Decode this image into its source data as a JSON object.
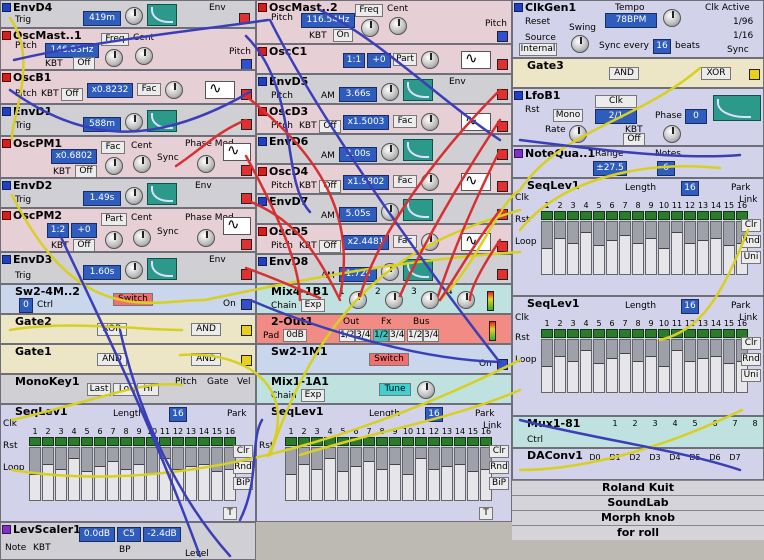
{
  "modules": {
    "envd4": {
      "title": "EnvD4",
      "trig": "Trig",
      "time": "419m",
      "env": "Env"
    },
    "oscmaster1": {
      "title": "OscMast..1",
      "pitch": "Pitch",
      "freq_label": "Freq",
      "cent_label": "Cent",
      "freq_value": "146.83Hz",
      "kbt": "KBT",
      "kbt_state": "Off",
      "pitch_out": "Pitch"
    },
    "oscb1": {
      "title": "OscB1",
      "pitch": "Pitch",
      "kbt": "KBT",
      "kbt_state": "Off",
      "ratio": "x0.8232",
      "fac": "Fac"
    },
    "envd1": {
      "title": "EnvD1",
      "trig": "Trig",
      "time": "588m"
    },
    "oscpm1": {
      "title": "OscPM1",
      "ratio": "x0.6802",
      "fac": "Fac",
      "cent": "Cent",
      "kbt": "KBT",
      "kbt_state": "Off",
      "sync": "Sync",
      "phase_mod": "Phase Mod"
    },
    "envd2": {
      "title": "EnvD2",
      "trig": "Trig",
      "time": "1.49s",
      "env": "Env"
    },
    "oscpm2": {
      "title": "OscPM2",
      "ratio": "1:2",
      "offset": "+0",
      "part": "Part",
      "cent": "Cent",
      "kbt": "KBT",
      "kbt_state": "Off",
      "sync": "Sync",
      "phase_mod": "Phase Mod"
    },
    "envd3": {
      "title": "EnvD3",
      "trig": "Trig",
      "time": "1.60s",
      "env": "Env"
    },
    "sw2_4m": {
      "title": "Sw2-4M..2",
      "ctrl_value": "0",
      "ctrl": "Ctrl",
      "switch": "Switch",
      "on": "On"
    },
    "gate2": {
      "title": "Gate2",
      "op1": "XOR",
      "op2": "AND"
    },
    "gate1": {
      "title": "Gate1",
      "op1": "AND",
      "op2": "AND"
    },
    "monokey1": {
      "title": "MonoKey1",
      "last": "Last",
      "lo": "Lo",
      "hi": "Hi",
      "pitch": "Pitch",
      "gate": "Gate",
      "vel": "Vel"
    },
    "seqlev_bl": {
      "title": "SeqLev1",
      "length_label": "Length",
      "length": "16",
      "park": "Park",
      "link": "Link",
      "clk": "Clk",
      "rst": "Rst",
      "loop": "Loop",
      "clr": "Clr",
      "rnd": "Rnd",
      "bip": "BiP",
      "t": "T"
    },
    "levscaler1": {
      "title": "LevScaler1",
      "note": "Note",
      "kbt": "KBT",
      "gain1": "0.0dB",
      "note_val": "C5",
      "gain2": "-2.4dB",
      "bp": "BP",
      "level": "Level"
    },
    "envd4_osc2": {
      "title": "OscMast..2",
      "pitch": "Pitch",
      "freq_value": "116.54Hz",
      "freq_label": "Freq",
      "cent_label": "Cent",
      "kbt": "KBT",
      "kbt_state": "On",
      "pitch_out": "Pitch"
    },
    "osc2": {
      "title": "OscC1",
      "ratio": "1:1",
      "offset": "+0",
      "part": "Part"
    },
    "envd5": {
      "title": "EnvD5",
      "am": "AM",
      "pitch": "Pitch",
      "time": "3.66s",
      "env": "Env"
    },
    "oscd3": {
      "title": "OscD3",
      "pitch": "Pitch",
      "kbt": "KBT",
      "kbt_state": "Off",
      "ratio": "x1.5003",
      "fac": "Fac"
    },
    "envd6": {
      "title": "EnvD6",
      "am": "AM",
      "time": "3.00s"
    },
    "oscd4": {
      "title": "OscD4",
      "pitch": "Pitch",
      "kbt": "KBT",
      "kbt_state": "Off",
      "ratio": "x1.9802",
      "fac": "Fac"
    },
    "envd7": {
      "title": "EnvD7",
      "am": "AM",
      "time": "5.05s"
    },
    "oscd5": {
      "title": "OscD5",
      "pitch": "Pitch",
      "kbt": "KBT",
      "kbt_state": "Off",
      "ratio": "x2.4481",
      "fac": "Fac"
    },
    "envd8": {
      "title": "EnvD8",
      "am": "AM",
      "time": "1.72s"
    },
    "mix4": {
      "title": "Mix4-1B1",
      "chain": "Chain",
      "exp": "Exp",
      "ch1": "1",
      "ch2": "2",
      "ch3": "3",
      "ch4": "4"
    },
    "out2": {
      "title": "2-Out1",
      "pad": "Pad",
      "pad_val": "0dB",
      "out_label": "Out",
      "fx": "Fx",
      "bus": "Bus",
      "b12": "1/2",
      "b34": "3/4"
    },
    "sw2_1m": {
      "title": "Sw2-1M1",
      "switch": "Switch",
      "on": "On"
    },
    "mix1": {
      "title": "Mix1-1A1",
      "chain": "Chain",
      "exp": "Exp",
      "tune": "Tune"
    },
    "seqlev_bm": {
      "title": "SeqLev1",
      "length_label": "Length",
      "length": "16",
      "park": "Park",
      "link": "Link",
      "clk": "Clk",
      "rst": "Rst",
      "loop": "Loop",
      "clr": "Clr",
      "rnd": "Rnd",
      "bip": "BiP",
      "t": "T"
    },
    "clkgen": {
      "title": "ClkGen1",
      "reset": "Reset",
      "tempo_label": "Tempo",
      "tempo": "78BPM",
      "clk_active": "Clk Active",
      "div1": "1/96",
      "div2": "1/16",
      "sync": "Sync",
      "source": "Source",
      "source_val": "Internal",
      "swing": "Swing",
      "sync_every": "Sync every",
      "sync_every_val": "16",
      "beats": "beats"
    },
    "gate3": {
      "title": "Gate3",
      "op1": "AND",
      "op2": "XOR"
    },
    "lfob1": {
      "title": "LfoB1",
      "rst": "Rst",
      "mono": "Mono",
      "clk": "Clk",
      "ratio": "2/1",
      "rate": "Rate",
      "kbt": "KBT",
      "kbt_state": "Off",
      "phase": "Phase",
      "phase_val": "0"
    },
    "notequant": {
      "title": "NoteQua..1",
      "range": "Range",
      "range_val": "±27.5",
      "notes": "Notes",
      "notes_val": "6"
    },
    "seqlev_r1": {
      "title": "SeqLev1",
      "length_label": "Length",
      "length": "16",
      "park": "Park",
      "link": "Link",
      "clk": "Clk",
      "rst": "Rst",
      "loop": "Loop",
      "clr": "Clr",
      "rnd": "Rnd",
      "uni": "Uni"
    },
    "seqlev_r2": {
      "title": "SeqLev1",
      "length_label": "Length",
      "length": "16",
      "park": "Park",
      "link": "Link",
      "clk": "Clk",
      "rst": "Rst",
      "loop": "Loop",
      "clr": "Clr",
      "rnd": "Rnd",
      "uni": "Uni"
    },
    "mux": {
      "title": "Mux1-81",
      "ctrl": "Ctrl",
      "nums": [
        "1",
        "2",
        "3",
        "4",
        "5",
        "6",
        "7",
        "8"
      ]
    },
    "daconv": {
      "title": "DAConv1",
      "outs": [
        "D0",
        "D1",
        "D2",
        "D3",
        "D4",
        "D5",
        "D6",
        "D7"
      ]
    }
  },
  "steps": [
    "1",
    "2",
    "3",
    "4",
    "5",
    "6",
    "7",
    "8",
    "9",
    "10",
    "11",
    "12",
    "13",
    "14",
    "15",
    "16"
  ],
  "side_menu": [
    "Roland Kuit",
    "SoundLab",
    "Morph knob",
    "for roll"
  ],
  "colors": {
    "display": "#2f5dbd",
    "env_screen": "#2c9a8a",
    "cable_yellow": "#d8d020",
    "cable_blue": "#3a3fb8",
    "cable_red": "#d83030"
  }
}
